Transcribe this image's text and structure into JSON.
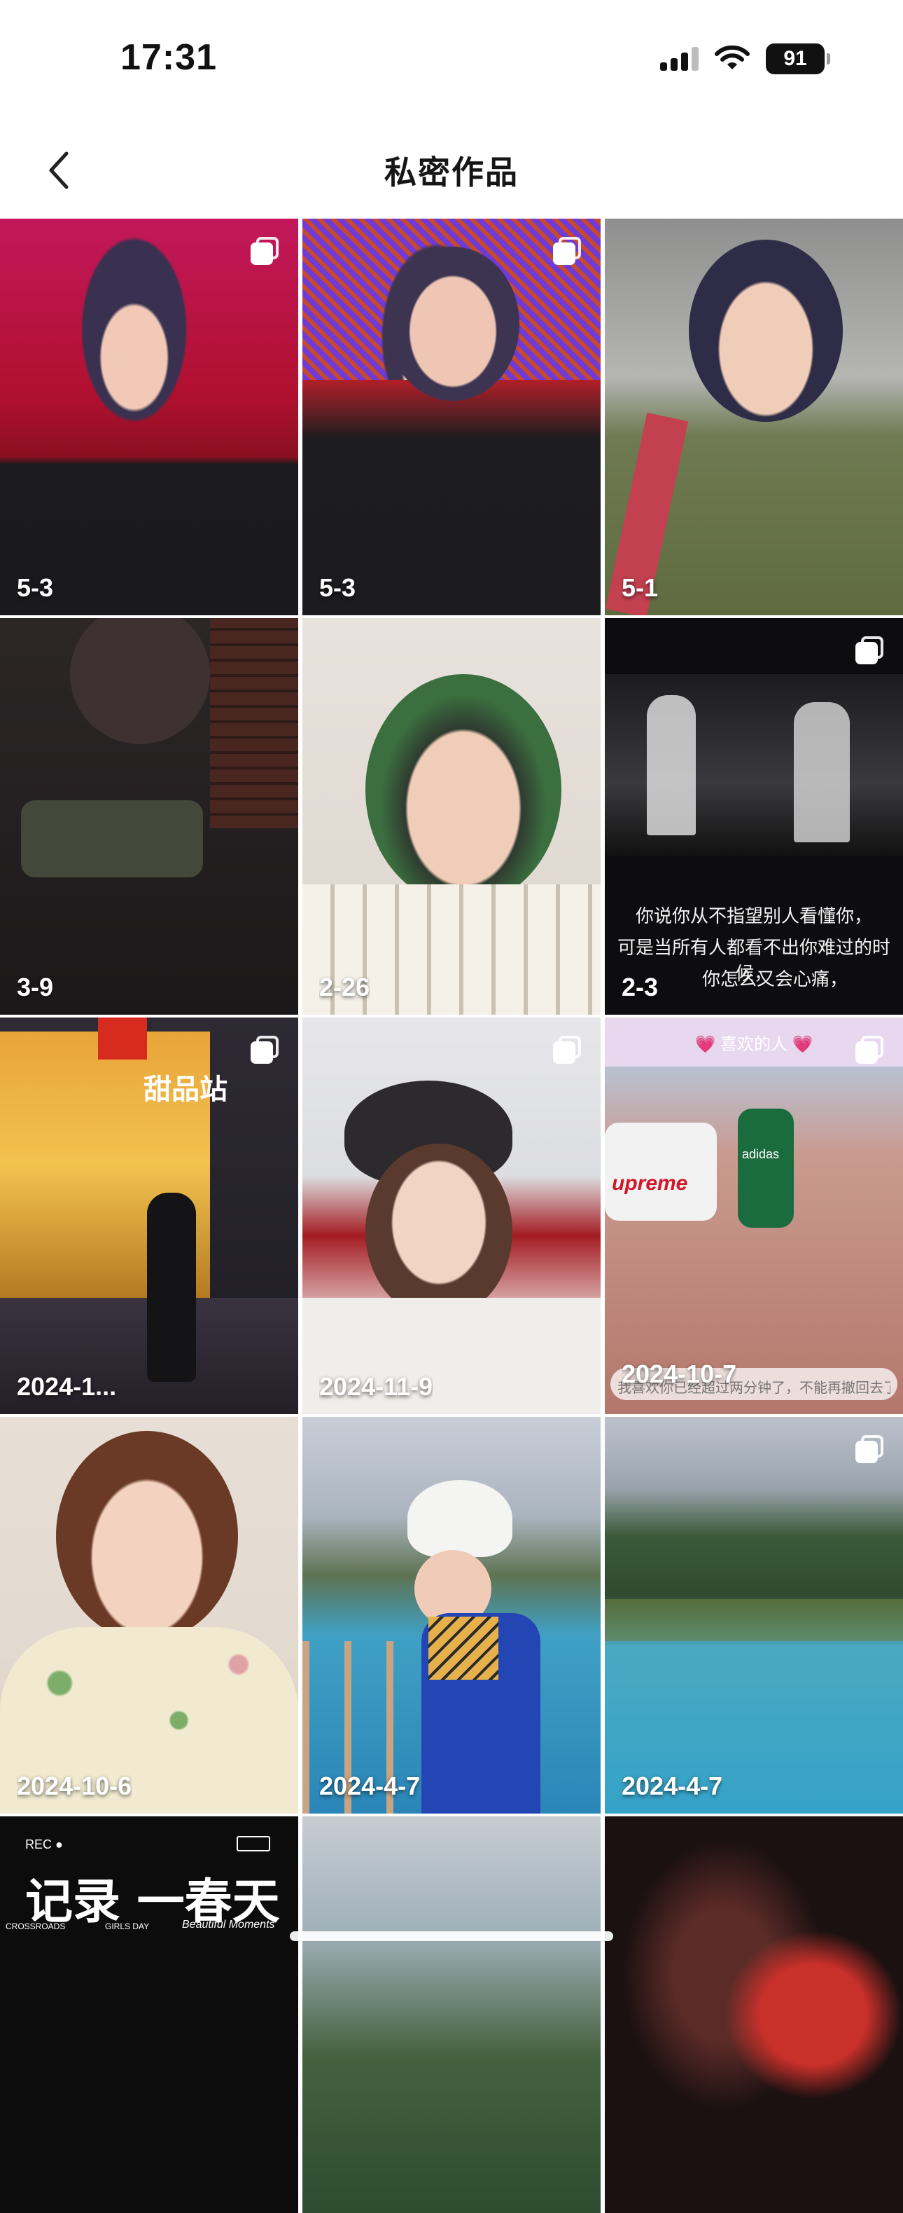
{
  "status_bar": {
    "time": "17:31",
    "battery_level": "91"
  },
  "nav": {
    "title": "私密作品"
  },
  "grid": {
    "items": [
      {
        "label": "5-3"
      },
      {
        "label": "5-3"
      },
      {
        "label": "5-1"
      },
      {
        "label": "3-9"
      },
      {
        "label": "2-26"
      },
      {
        "label": "2-3",
        "caption": [
          "你说你从不指望别人看懂你，",
          "可是当所有人都看不出你难过的时候，",
          "你怎么又会心痛，"
        ]
      },
      {
        "label": "2024-1...",
        "sign": "甜品站"
      },
      {
        "label": "2024-11-9"
      },
      {
        "label": "2024-10-7",
        "header": "💗 喜欢的人 💗",
        "footer": "我喜欢你已经超过两分钟了，不能再撤回去了 💗",
        "shirt": "adidas",
        "car": "upreme"
      },
      {
        "label": "2024-10-6"
      },
      {
        "label": "2024-4-7"
      },
      {
        "label": "2024-4-7"
      },
      {
        "rec": "REC",
        "title": "记录 一春天",
        "subtitle_left": "CROSSROADS",
        "subtitle_mid": "GIRLS DAY",
        "subtitle_right": "Beautiful Moments"
      },
      {},
      {}
    ]
  }
}
